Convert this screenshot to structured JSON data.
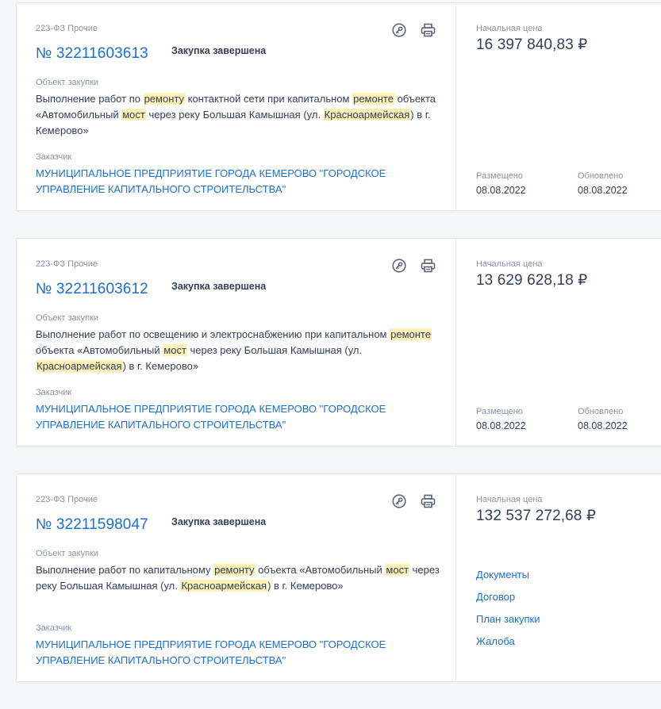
{
  "cards": [
    {
      "law": "223-ФЗ Прочие",
      "number": "№ 32211603613",
      "status": "Закупка завершена",
      "object_label": "Объект закупки",
      "description": [
        {
          "t": "Выполнение работ по ",
          "hl": false
        },
        {
          "t": "ремонту",
          "hl": true
        },
        {
          "t": " контактной сети при капитальном ",
          "hl": false
        },
        {
          "t": "ремонте",
          "hl": true
        },
        {
          "t": " объекта «Автомобильный ",
          "hl": false
        },
        {
          "t": "мост",
          "hl": true
        },
        {
          "t": " через реку Большая Камышная (ул. ",
          "hl": false
        },
        {
          "t": "Красноармейская",
          "hl": true
        },
        {
          "t": ") в г. Кемерово»",
          "hl": false
        }
      ],
      "customer_label": "Заказчик",
      "customer": "МУНИЦИПАЛЬНОЕ ПРЕДПРИЯТИЕ ГОРОДА КЕМЕРОВО \"ГОРОДСКОЕ УПРАВЛЕНИЕ КАПИТАЛЬНОГО СТРОИТЕЛЬСТВА\"",
      "price_label": "Начальная цена",
      "price": "16 397 840,83 ₽",
      "placed_label": "Размещено",
      "placed": "08.08.2022",
      "updated_label": "Обновлено",
      "updated": "08.08.2022",
      "links": []
    },
    {
      "law": "223-ФЗ Прочие",
      "number": "№ 32211603612",
      "status": "Закупка завершена",
      "object_label": "Объект закупки",
      "description": [
        {
          "t": "Выполнение работ по освещению и электроснабжению при капитальном ",
          "hl": false
        },
        {
          "t": "ремонте",
          "hl": true
        },
        {
          "t": " объекта «Автомобильный ",
          "hl": false
        },
        {
          "t": "мост",
          "hl": true
        },
        {
          "t": " через реку Большая Камышная (ул. ",
          "hl": false
        },
        {
          "t": "Красноармейская",
          "hl": true
        },
        {
          "t": ") в г. Кемерово»",
          "hl": false
        }
      ],
      "customer_label": "Заказчик",
      "customer": "МУНИЦИПАЛЬНОЕ ПРЕДПРИЯТИЕ ГОРОДА КЕМЕРОВО \"ГОРОДСКОЕ УПРАВЛЕНИЕ КАПИТАЛЬНОГО СТРОИТЕЛЬСТВА\"",
      "price_label": "Начальная цена",
      "price": "13 629 628,18 ₽",
      "placed_label": "Размещено",
      "placed": "08.08.2022",
      "updated_label": "Обновлено",
      "updated": "08.08.2022",
      "links": []
    },
    {
      "law": "223-ФЗ Прочие",
      "number": "№ 32211598047",
      "status": "Закупка завершена",
      "object_label": "Объект закупки",
      "description": [
        {
          "t": "Выполнение работ по капитальному ",
          "hl": false
        },
        {
          "t": "ремонту",
          "hl": true
        },
        {
          "t": " объекта «Автомобильный ",
          "hl": false
        },
        {
          "t": "мост",
          "hl": true
        },
        {
          "t": " через реку Большая Камышная (ул. ",
          "hl": false
        },
        {
          "t": "Красноармейская",
          "hl": true
        },
        {
          "t": ") в г. Кемерово»",
          "hl": false
        }
      ],
      "customer_label": "Заказчик",
      "customer": "МУНИЦИПАЛЬНОЕ ПРЕДПРИЯТИЕ ГОРОДА КЕМЕРОВО \"ГОРОДСКОЕ УПРАВЛЕНИЕ КАПИТАЛЬНОГО СТРОИТЕЛЬСТВА\"",
      "price_label": "Начальная цена",
      "price": "132 537 272,68 ₽",
      "placed_label": "",
      "placed": "",
      "updated_label": "",
      "updated": "",
      "links": [
        "Документы",
        "Договор",
        "План закупки",
        "Жалоба"
      ]
    }
  ],
  "icons": {
    "key": "key-icon",
    "print": "printer-icon"
  },
  "colors": {
    "link": "#1a6fd1",
    "highlight": "#fdf1b6",
    "muted": "#8a93a6",
    "text": "#334059",
    "icon": "#5b6478"
  }
}
